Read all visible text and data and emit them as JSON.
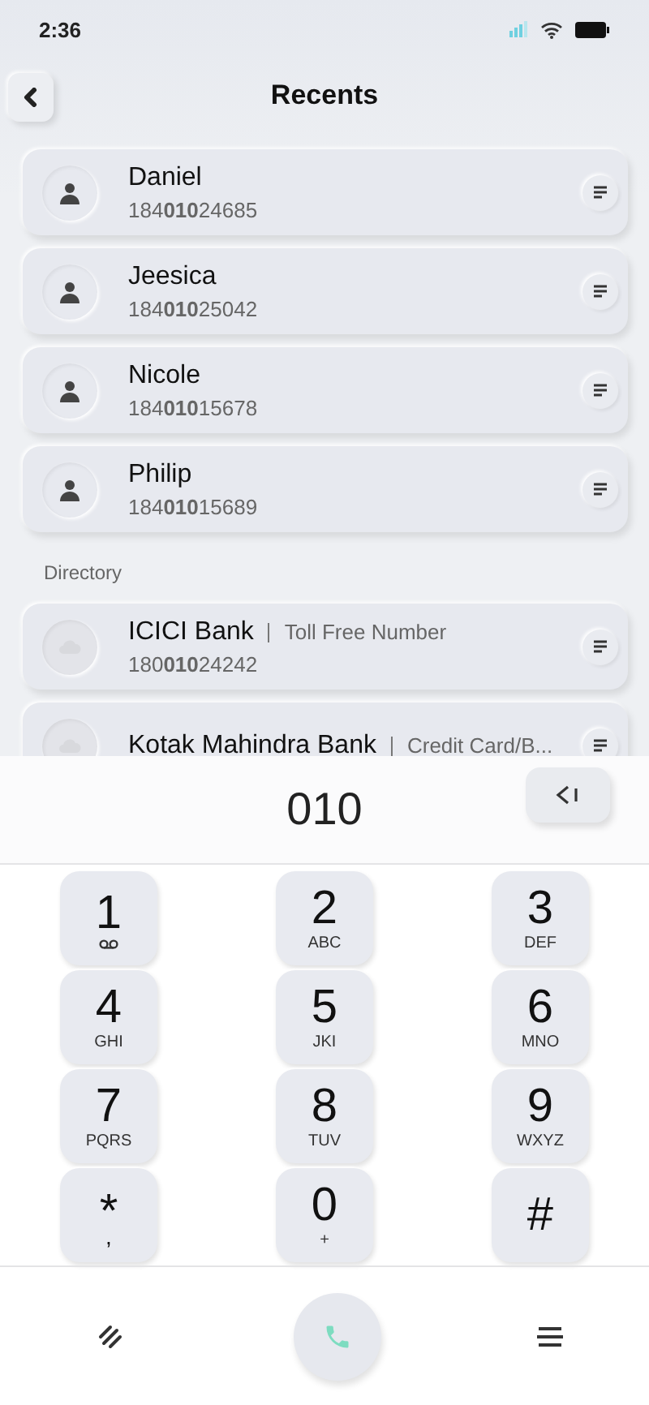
{
  "status_bar": {
    "time": "2:36"
  },
  "header": {
    "title": "Recents"
  },
  "recents": [
    {
      "name": "Daniel",
      "number": "184**010**24685"
    },
    {
      "name": "Jeesica",
      "number": "184**010**25042"
    },
    {
      "name": "Nicole",
      "number": "184**010**15678"
    },
    {
      "name": "Philip",
      "number": "184**010**15689"
    }
  ],
  "directory": {
    "label": "Directory",
    "items": [
      {
        "name": "ICICI Bank",
        "tag": "Toll Free Number",
        "number": "180**010**24242"
      },
      {
        "name": "Kotak Mahindra Bank",
        "tag": "Credit Card/B..."
      }
    ]
  },
  "dialer": {
    "input": "010",
    "keys": [
      {
        "kind": "voicemail",
        "digit": "1"
      },
      {
        "kind": "letters",
        "digit": "2",
        "letters": "ABC"
      },
      {
        "kind": "letters",
        "digit": "3",
        "letters": "DEF"
      },
      {
        "kind": "letters",
        "digit": "4",
        "letters": "GHI"
      },
      {
        "kind": "letters",
        "digit": "5",
        "letters": "JKI"
      },
      {
        "kind": "letters",
        "digit": "6",
        "letters": "MNO"
      },
      {
        "kind": "letters",
        "digit": "7",
        "letters": "PQRS"
      },
      {
        "kind": "letters",
        "digit": "8",
        "letters": "TUV"
      },
      {
        "kind": "letters",
        "digit": "9",
        "letters": "WXYZ"
      },
      {
        "kind": "symbol",
        "digit": "*",
        "letters": ","
      },
      {
        "kind": "letters",
        "digit": "0",
        "letters": "+"
      },
      {
        "kind": "symbol",
        "digit": "#"
      }
    ]
  }
}
